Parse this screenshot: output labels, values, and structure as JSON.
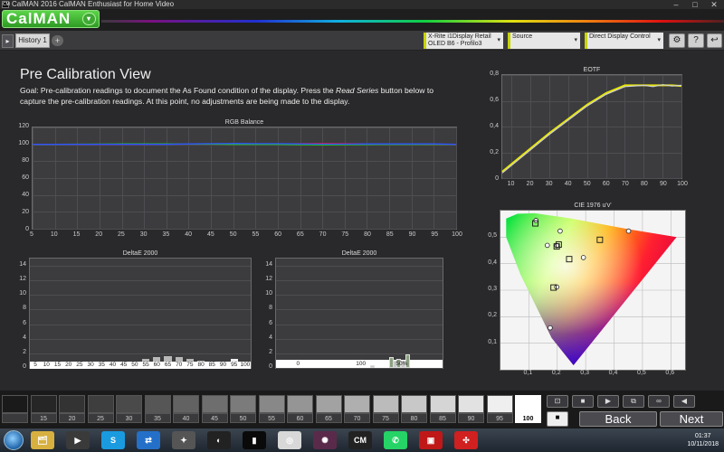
{
  "window": {
    "title": "CalMAN 2016 CalMAN Enthusiast for Home Video",
    "app_icon": "CM",
    "controls": [
      "–",
      "□",
      "✕"
    ]
  },
  "header": {
    "logo": "CalMAN",
    "logo_dropdown": "▾"
  },
  "toolbar": {
    "tab_label": "History 1",
    "add_tab": "+",
    "left_arrow": "▸",
    "devices": [
      {
        "line1": "X-Rite i1Display Retail",
        "line2": "OLED B6 - Profilo3"
      },
      {
        "line1": "Source",
        "line2": ""
      },
      {
        "line1": "Direct Display Control",
        "line2": ""
      }
    ],
    "dropdown_arrow": "▾",
    "buttons": [
      "⚙",
      "?",
      "↩"
    ]
  },
  "page": {
    "title": "Pre Calibration View",
    "goal_prefix": "Goal: Pre-calibration readings to document the As Found condition of the display. Press the ",
    "goal_em": "Read Series",
    "goal_suffix": " button below to capture the pre-calibration readings. At this point, no adjustments are being made to the display."
  },
  "colors": {
    "accent": "#5cd44a",
    "device_bar": "#c8d400",
    "plot_bg": "#3c3c3e",
    "eotf_target": "#e8e800",
    "eotf_measured": "#d0d0d0"
  },
  "chart_data": [
    {
      "type": "line",
      "title": "RGB Balance",
      "x": [
        5,
        10,
        15,
        20,
        25,
        30,
        35,
        40,
        45,
        50,
        55,
        60,
        65,
        70,
        75,
        80,
        85,
        90,
        95,
        100
      ],
      "xlim": [
        5,
        100
      ],
      "ylim": [
        0,
        120
      ],
      "yticks": [
        0,
        20,
        40,
        60,
        80,
        100,
        120
      ],
      "series": [
        {
          "color": "#e02020",
          "values": [
            100,
            100,
            100,
            100,
            100,
            100,
            100.3,
            100.3,
            100.3,
            100.3,
            100.3,
            100.3,
            100.8,
            101,
            100.8,
            100.5,
            100.3,
            100.3,
            100,
            100
          ]
        },
        {
          "color": "#20c020",
          "values": [
            100,
            100,
            100.2,
            100.3,
            100.5,
            100.5,
            100.5,
            100.3,
            100.3,
            100,
            100,
            100,
            99.5,
            99.3,
            99.5,
            99.7,
            100,
            100,
            100,
            100
          ]
        },
        {
          "color": "#3050ff",
          "values": [
            100,
            100,
            100,
            100,
            100,
            100,
            100,
            100.5,
            100.8,
            101,
            100.8,
            100.8,
            100.5,
            100.3,
            100.3,
            100.5,
            100.5,
            100.5,
            100.5,
            100
          ]
        }
      ]
    },
    {
      "type": "bar",
      "title": "DeltaE 2000",
      "categories": [
        "5",
        "10",
        "15",
        "20",
        "25",
        "30",
        "35",
        "40",
        "45",
        "50",
        "55",
        "60",
        "65",
        "70",
        "75",
        "80",
        "85",
        "90",
        "95",
        "100"
      ],
      "values": [
        0,
        0,
        0,
        0,
        0.2,
        0.3,
        0.4,
        0.5,
        0.6,
        0.8,
        1.2,
        1.5,
        1.6,
        1.5,
        1.2,
        1.0,
        0.8,
        0.6,
        1.2,
        0.6
      ],
      "ylim": [
        0,
        15
      ],
      "yticks": [
        0,
        2,
        4,
        6,
        8,
        10,
        12,
        14
      ]
    },
    {
      "type": "bar",
      "title": "DeltaE 2000",
      "categories": [
        "0",
        "100",
        "50%"
      ],
      "bars": [
        {
          "x": 119,
          "value": 0.4
        },
        {
          "x": 148,
          "value": 1.5
        },
        {
          "x": 154,
          "value": 1.0
        },
        {
          "x": 160,
          "value": 1.3
        },
        {
          "x": 167,
          "value": 1.0
        },
        {
          "x": 174,
          "value": 1.8
        }
      ],
      "xticks": [
        {
          "x": 0,
          "label": "0"
        },
        {
          "x": 100,
          "label": "100"
        },
        {
          "x": 165,
          "label": "50%"
        }
      ],
      "xlim": [
        -35,
        230
      ],
      "ylim": [
        0,
        15
      ],
      "yticks": [
        0,
        2,
        4,
        6,
        8,
        10,
        12,
        14
      ]
    },
    {
      "type": "line",
      "title": "EOTF",
      "x": [
        5,
        10,
        20,
        30,
        40,
        50,
        60,
        70,
        75,
        80,
        85,
        90,
        95,
        100
      ],
      "xlim": [
        5,
        100
      ],
      "ylim": [
        0,
        0.8
      ],
      "xticks": [
        10,
        20,
        30,
        40,
        50,
        60,
        70,
        80,
        90,
        100
      ],
      "yticks": [
        0,
        0.2,
        0.4,
        0.6,
        0.8
      ],
      "series": [
        {
          "name": "target",
          "values": [
            0.05,
            0.11,
            0.23,
            0.35,
            0.46,
            0.57,
            0.66,
            0.72,
            0.72,
            0.72,
            0.72,
            0.72,
            0.72,
            0.715
          ]
        },
        {
          "name": "measured",
          "values": [
            0.04,
            0.1,
            0.22,
            0.34,
            0.45,
            0.56,
            0.65,
            0.71,
            0.715,
            0.72,
            0.71,
            0.725,
            0.715,
            0.72
          ]
        }
      ]
    },
    {
      "type": "scatter",
      "title": "CIE 1976 u'v'",
      "xlim": [
        0,
        0.65
      ],
      "ylim": [
        0,
        0.6
      ],
      "xticks": [
        0.1,
        0.2,
        0.3,
        0.4,
        0.5,
        0.6
      ],
      "yticks": [
        0.1,
        0.2,
        0.3,
        0.4,
        0.5
      ],
      "target_points": [
        {
          "u": 0.451,
          "v": 0.523
        },
        {
          "u": 0.125,
          "v": 0.563
        },
        {
          "u": 0.175,
          "v": 0.158
        },
        {
          "u": 0.198,
          "v": 0.468
        },
        {
          "u": 0.21,
          "v": 0.523
        },
        {
          "u": 0.165,
          "v": 0.469
        },
        {
          "u": 0.292,
          "v": 0.423
        },
        {
          "u": 0.198,
          "v": 0.312
        }
      ],
      "measured_points": [
        {
          "u": 0.35,
          "v": 0.49
        },
        {
          "u": 0.123,
          "v": 0.552
        },
        {
          "u": 0.205,
          "v": 0.472
        },
        {
          "u": 0.198,
          "v": 0.465
        },
        {
          "u": 0.242,
          "v": 0.417
        },
        {
          "u": 0.187,
          "v": 0.31
        }
      ]
    }
  ],
  "labels": {
    "rgb_yticks": [
      "0",
      "20",
      "40",
      "60",
      "80",
      "100",
      "120"
    ],
    "rgb_xticks": [
      "5",
      "10",
      "15",
      "20",
      "25",
      "30",
      "35",
      "40",
      "45",
      "50",
      "55",
      "60",
      "65",
      "70",
      "75",
      "80",
      "85",
      "90",
      "95",
      "100"
    ],
    "de_yticks": [
      "0",
      "2",
      "4",
      "6",
      "8",
      "10",
      "12",
      "14"
    ],
    "de2_xticks": [
      "0",
      "100",
      "50%"
    ],
    "eotf_yticks": [
      "0",
      "0,2",
      "0,4",
      "0,6",
      "0,8"
    ],
    "eotf_xticks": [
      "10",
      "20",
      "30",
      "40",
      "50",
      "60",
      "70",
      "80",
      "90",
      "100"
    ],
    "cie_xticks": [
      "0,1",
      "0,2",
      "0,3",
      "0,4",
      "0,5",
      "0,6"
    ],
    "cie_yticks": [
      "0,1",
      "0,2",
      "0,3",
      "0,4",
      "0,5"
    ]
  },
  "strip": {
    "patches": [
      {
        "label": "",
        "gray": "#1a1a1a"
      },
      {
        "label": "15",
        "gray": "#262626"
      },
      {
        "label": "20",
        "gray": "#333"
      },
      {
        "label": "25",
        "gray": "#3e3e3e"
      },
      {
        "label": "30",
        "gray": "#4a4a4a"
      },
      {
        "label": "35",
        "gray": "#565656"
      },
      {
        "label": "40",
        "gray": "#626262"
      },
      {
        "label": "45",
        "gray": "#6e6e6e"
      },
      {
        "label": "50",
        "gray": "#7b7b7b"
      },
      {
        "label": "55",
        "gray": "#888"
      },
      {
        "label": "60",
        "gray": "#959595"
      },
      {
        "label": "65",
        "gray": "#a2a2a2"
      },
      {
        "label": "70",
        "gray": "#afafaf"
      },
      {
        "label": "75",
        "gray": "#bbb"
      },
      {
        "label": "80",
        "gray": "#c8c8c8"
      },
      {
        "label": "85",
        "gray": "#d5d5d5"
      },
      {
        "label": "90",
        "gray": "#e2e2e2"
      },
      {
        "label": "95",
        "gray": "#efefef"
      },
      {
        "label": "100",
        "gray": "#fff"
      }
    ],
    "selected_index": 18,
    "controls": [
      "⊡",
      "■",
      "▶",
      "⧉",
      "∞",
      "◀"
    ],
    "back": "Back",
    "next": "Next"
  },
  "taskbar": {
    "apps": [
      {
        "txt": "🗂",
        "bg": "#d8b040"
      },
      {
        "txt": "▶",
        "bg": "#3a3a3a"
      },
      {
        "txt": "S",
        "bg": "#1a9be0"
      },
      {
        "txt": "⇄",
        "bg": "#2470c8"
      },
      {
        "txt": "✦",
        "bg": "#555"
      },
      {
        "txt": "◐",
        "bg": "#222"
      },
      {
        "txt": "▮",
        "bg": "#0a0a0a"
      },
      {
        "txt": "◎",
        "bg": "#d8d8d8"
      },
      {
        "txt": "✺",
        "bg": "#5a2a4a"
      },
      {
        "txt": "CM",
        "bg": "#222"
      },
      {
        "txt": "✆",
        "bg": "#25d366"
      },
      {
        "txt": "▣",
        "bg": "#c01818"
      },
      {
        "txt": "✣",
        "bg": "#d02020"
      }
    ],
    "time": "01:37",
    "date": "10/11/2018"
  }
}
